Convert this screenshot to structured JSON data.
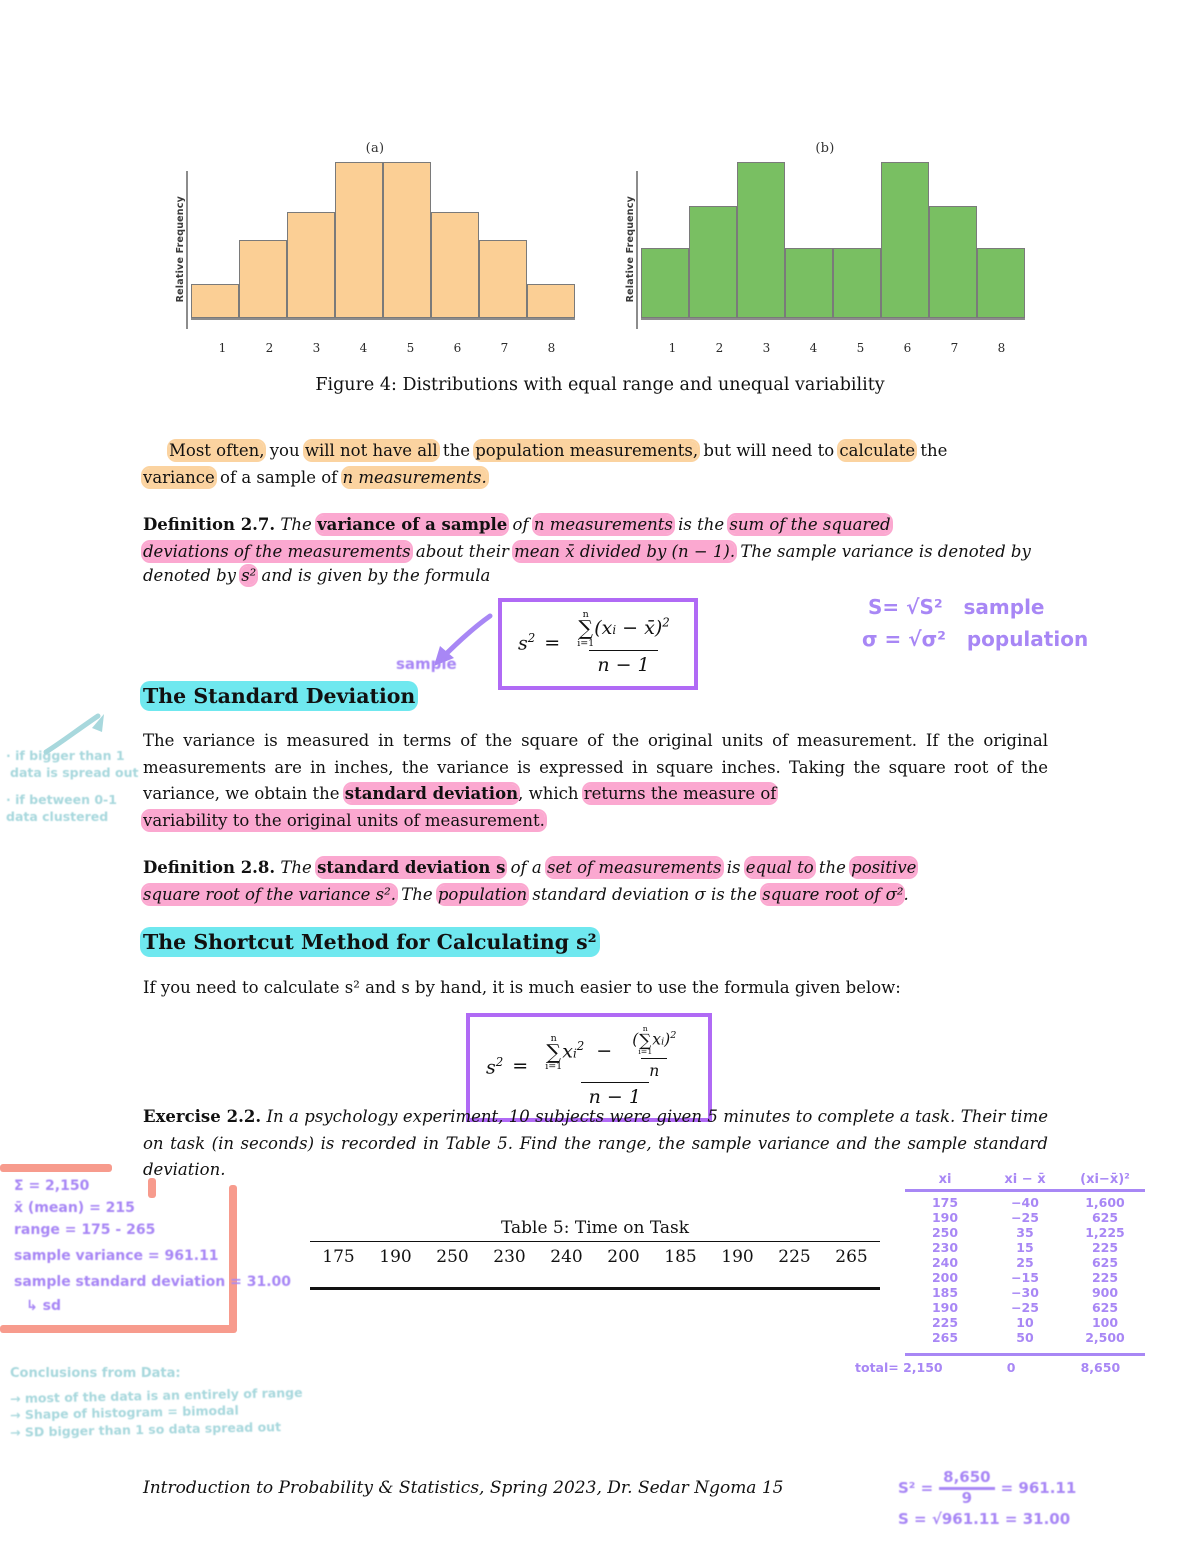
{
  "figure": {
    "panel_a_label": "(a)",
    "panel_b_label": "(b)",
    "ylabel": "Relative Frequency",
    "caption": "Figure 4: Distributions with equal range and unequal variability"
  },
  "chart_data": [
    {
      "type": "bar",
      "title": "(a)",
      "categories": [
        "1",
        "2",
        "3",
        "4",
        "5",
        "6",
        "7",
        "8"
      ],
      "values": [
        22,
        50,
        68,
        100,
        100,
        68,
        50,
        22
      ],
      "xlabel": "",
      "ylabel": "Relative Frequency",
      "ylim": [
        0,
        110
      ],
      "color": "#fbcf95",
      "grid": false,
      "legend": "none"
    },
    {
      "type": "bar",
      "title": "(b)",
      "categories": [
        "1",
        "2",
        "3",
        "4",
        "5",
        "6",
        "7",
        "8"
      ],
      "values": [
        45,
        72,
        100,
        45,
        45,
        100,
        72,
        45
      ],
      "xlabel": "",
      "ylabel": "Relative Frequency",
      "ylim": [
        0,
        110
      ],
      "color": "#79bf62",
      "grid": false,
      "legend": "none"
    }
  ],
  "paragraphs": {
    "intro_p1": "Most often, you will not have all the population measurements, but will need to calculate the variance of a sample of n measurements.",
    "intro_seg": {
      "s1": "Most often,",
      "s2": " you ",
      "s3": "will not have all",
      "s4": " the ",
      "s5": "population measurements,",
      "s6": " but will need to ",
      "s7": "calculate",
      "s8": " the ",
      "s9": "variance",
      "s10": " of a sample of ",
      "s11": "n measurements."
    },
    "def27": {
      "tag": "Definition 2.7.",
      "t1": "The ",
      "t2": "variance of a sample",
      "t3": " of ",
      "t4": "n measurements",
      "t5": " is the ",
      "t6": "sum of the squared",
      "t7": "deviations of the measurements",
      "t8": " about their ",
      "t9": "mean x̄ divided by (n − 1).",
      "t10": " The sample variance is denoted by ",
      "t11": "s²",
      "t12": " and is given by the formula"
    },
    "std_dev_heading": "The Standard Deviation",
    "std_dev_body": {
      "p1": "The variance is measured in terms of the square of the original units of measurement.  If the original measurements are in inches, the variance is expressed in square inches.  Taking the square root of the variance, we obtain the ",
      "p2": "standard deviation",
      "p3": ", which ",
      "p4": "returns the measure of",
      "p5": "variability to the original units of measurement."
    },
    "def28": {
      "tag": "Definition 2.8.",
      "t1": "The ",
      "t2": "standard deviation s",
      "t3": " of a ",
      "t4": "set of measurements",
      "t5": " is ",
      "t6": "equal to",
      "t7": " the ",
      "t8": "positive",
      "t9": "square root of the variance s².",
      "t10": " The ",
      "t11": "population",
      "t12": " standard deviation σ is the ",
      "t13": "square root of σ²",
      "t14": "."
    },
    "shortcut_heading": "The Shortcut Method for Calculating s²",
    "shortcut_body": "If you need to calculate s² and s by hand, it is much easier to use the formula given below:",
    "exercise": {
      "tag": "Exercise 2.2.",
      "text": "In a psychology experiment, 10 subjects were given 5 minutes to complete a task. Their time on task (in seconds) is recorded in Table 5. Find the range, the sample variance and the sample standard deviation."
    }
  },
  "formula1": {
    "lhs": "s",
    "lhs_exp": "2",
    "eq": "=",
    "sum_top": "n",
    "sum_bot": "i=1",
    "num_body": "(x",
    "num_sub": "i",
    "num_rest": " − x̄)",
    "num_exp": "2",
    "den": "n − 1"
  },
  "formula2": {
    "lhs": "s",
    "lhs_exp": "2",
    "eq": "=",
    "sum_top": "n",
    "sum_bot": "i=1",
    "term1": "x",
    "term1_sub": "i",
    "term1_exp": "2",
    "minus": "−",
    "inner_sum_top": "n",
    "inner_sum_bot": "i=1",
    "inner_term": "x",
    "inner_sub": "i",
    "inner_exp": "2",
    "inner_den": "n",
    "den": "n − 1"
  },
  "table5": {
    "caption": "Table 5: Time on Task",
    "values": [
      "175",
      "190",
      "250",
      "230",
      "240",
      "200",
      "185",
      "190",
      "225",
      "265"
    ]
  },
  "hand_notes": {
    "formula1_arrow_label": "sample",
    "right_of_formula1_line1": "S= √S²   sample",
    "right_of_formula1_line2": "σ = √σ²   population",
    "left_margin_line1": "· if bigger than 1",
    "left_margin_line2": "data is spread out",
    "left_margin_line3": "· if between 0-1",
    "left_margin_line4": "data clustered",
    "work_line1": "Σ = 2,150",
    "work_line2": "x̄ (mean) = 215",
    "work_line3": "range = 175 - 265",
    "work_line4": "sample variance = 961.11",
    "work_line5": "sample standard deviation = 31.00",
    "work_line6": "↳ sd",
    "conclusions_title": "Conclusions from Data:",
    "conclusion1": "→ most of the data is an entirely of range",
    "conclusion2": "→ Shape of histogram = bimodal",
    "conclusion3": "→ SD bigger than 1 so data spread out",
    "final_calc_line1_lhs": "S² =",
    "final_calc_line1_num": "8,650",
    "final_calc_line1_den": "9",
    "final_calc_line1_res": "= 961.11",
    "final_calc_line2": "S = √961.11 = 31.00"
  },
  "hand_table": {
    "headers": [
      "xi",
      "xi − x̄",
      "(xi−x̄)²"
    ],
    "rows": [
      [
        "175",
        "−40",
        "1,600"
      ],
      [
        "190",
        "−25",
        "625"
      ],
      [
        "250",
        "35",
        "1,225"
      ],
      [
        "230",
        "15",
        "225"
      ],
      [
        "240",
        "25",
        "625"
      ],
      [
        "200",
        "−15",
        "225"
      ],
      [
        "185",
        "−30",
        "900"
      ],
      [
        "190",
        "−25",
        "625"
      ],
      [
        "225",
        "10",
        "100"
      ],
      [
        "265",
        "50",
        "2,500"
      ]
    ],
    "totals": [
      "total= 2,150",
      "0",
      "8,650"
    ]
  },
  "footer": "Introduction to Probability & Statistics, Spring 2023, Dr. Sedar Ngoma  15",
  "colors": {
    "highlight_orange": "#fbd3a0",
    "highlight_pink": "#fba8d0",
    "highlight_cyan": "#6fe8ef",
    "hand_purple": "#a887f5",
    "hand_teal": "#a8d8dd",
    "bracket_red": "#f79b8d",
    "bar_a": "#fbcf95",
    "bar_b": "#79bf62",
    "formula_border": "#b06af5"
  }
}
